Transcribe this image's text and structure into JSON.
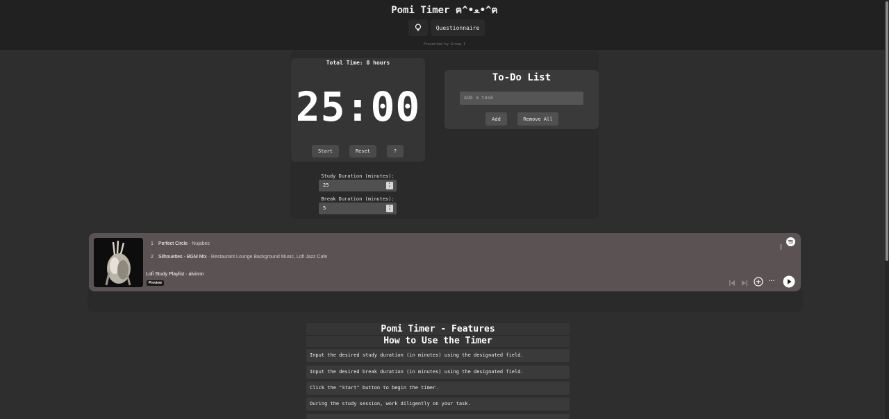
{
  "header": {
    "title": "Pomi Timer ฅ^•ﻌ•^ฅ",
    "questionnaire_label": "Questionnaire",
    "bulb_icon": "lightbulb-icon",
    "presented_by": "Presented by Group 1"
  },
  "timer": {
    "total_time": "Total Time: 0 hours",
    "display": "25:00",
    "start_label": "Start",
    "reset_label": "Reset",
    "help_label": "?"
  },
  "durations": {
    "study_label": "Study Duration (minutes):",
    "study_value": "25",
    "break_label": "Break Duration (minutes):",
    "break_value": "5"
  },
  "todo": {
    "title": "To-Do List",
    "placeholder": "Add a task",
    "add_label": "Add",
    "remove_all_label": "Remove All"
  },
  "spotify": {
    "tracks": [
      {
        "num": "1",
        "title": "Perfect Circle",
        "artist": "Nujabes"
      },
      {
        "num": "2",
        "title": "Silhouettes - BGM Mix",
        "artist": "Restaurant Lounge Background Music, Lofi Jazz Cafe"
      }
    ],
    "separator": " · ",
    "playlist": "Lofi Study Playlist · alvinnn",
    "preview_badge": "Preview",
    "icons": [
      "spotify-logo-icon",
      "skip-previous-icon",
      "skip-next-icon",
      "add-circle-icon",
      "more-icon",
      "play-icon"
    ],
    "more_glyph": "···"
  },
  "features": {
    "title": "Pomi Timer - Features",
    "subtitle": "How to Use the Timer",
    "items": [
      "Input the desired study duration (in minutes) using the designated field.",
      "Input the desired break duration (in minutes) using the designated field.",
      "Click the \"Start\" button to begin the timer.",
      "During the study session, work diligently on your task."
    ]
  },
  "colors": {
    "background": "#2e2e2e",
    "header": "#212121",
    "card": "#353535",
    "spotify_card": "#5a5253"
  }
}
